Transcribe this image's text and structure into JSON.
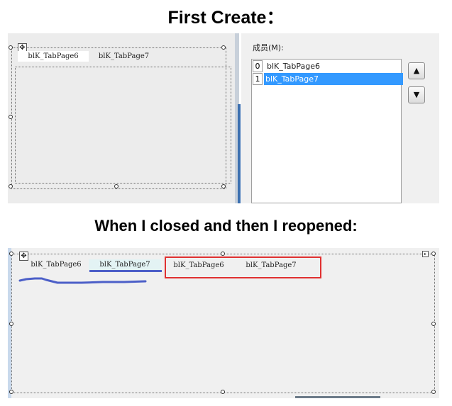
{
  "headings": {
    "first": "First Create：",
    "second": "When I closed and then I reopened:"
  },
  "designer_first": {
    "tabs": [
      {
        "label": "blK_TabPage6",
        "active": true
      },
      {
        "label": "blK_TabPage7",
        "active": false
      }
    ],
    "move_icon": "move-arrows-icon"
  },
  "collection_editor": {
    "members_label": "成员(M):",
    "members": [
      {
        "index": "0",
        "label": "blK_TabPage6",
        "selected": false
      },
      {
        "index": "1",
        "label": "blK_TabPage7",
        "selected": true
      }
    ],
    "move_up_icon": "arrow-up-icon",
    "move_down_icon": "arrow-down-icon"
  },
  "designer_reopened": {
    "tabs": [
      {
        "label": "blK_TabPage6",
        "active": false
      },
      {
        "label": "blK_TabPage7",
        "active": true
      }
    ],
    "duplicate_tabs": [
      {
        "label": "blK_TabPage6"
      },
      {
        "label": "blK_TabPage7"
      }
    ],
    "highlight_color": "#e03030",
    "annotation_color": "#4c5fc8"
  }
}
